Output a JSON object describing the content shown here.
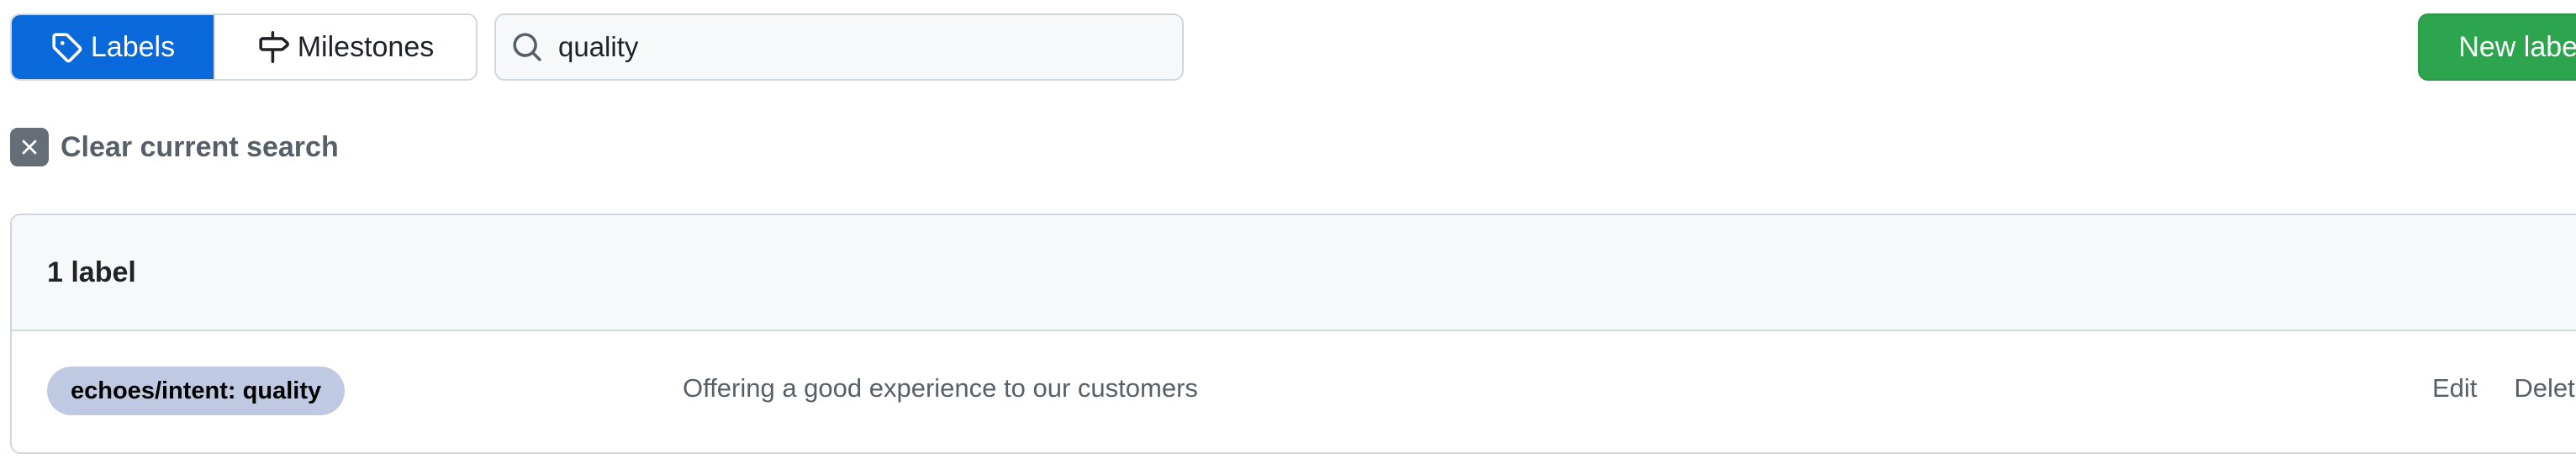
{
  "nav": {
    "tabs": [
      {
        "label": "Labels",
        "icon": "tag-icon",
        "selected": true
      },
      {
        "label": "Milestones",
        "icon": "milestone-icon",
        "selected": false
      }
    ]
  },
  "search": {
    "value": "quality",
    "icon": "search-icon"
  },
  "new_label_button": "New label",
  "clear_search": {
    "label": "Clear current search",
    "icon": "x-icon"
  },
  "labels_box": {
    "count_text": "1 label",
    "rows": [
      {
        "name": "echoes/intent: quality",
        "color": "#bfc9e2",
        "description": "Offering a good experience to our customers",
        "edit_label": "Edit",
        "delete_label": "Delete"
      }
    ]
  },
  "colors": {
    "accent": "#0969da",
    "primary_button": "#2da44e",
    "border": "#d0d7de",
    "muted_text": "#57606a"
  }
}
